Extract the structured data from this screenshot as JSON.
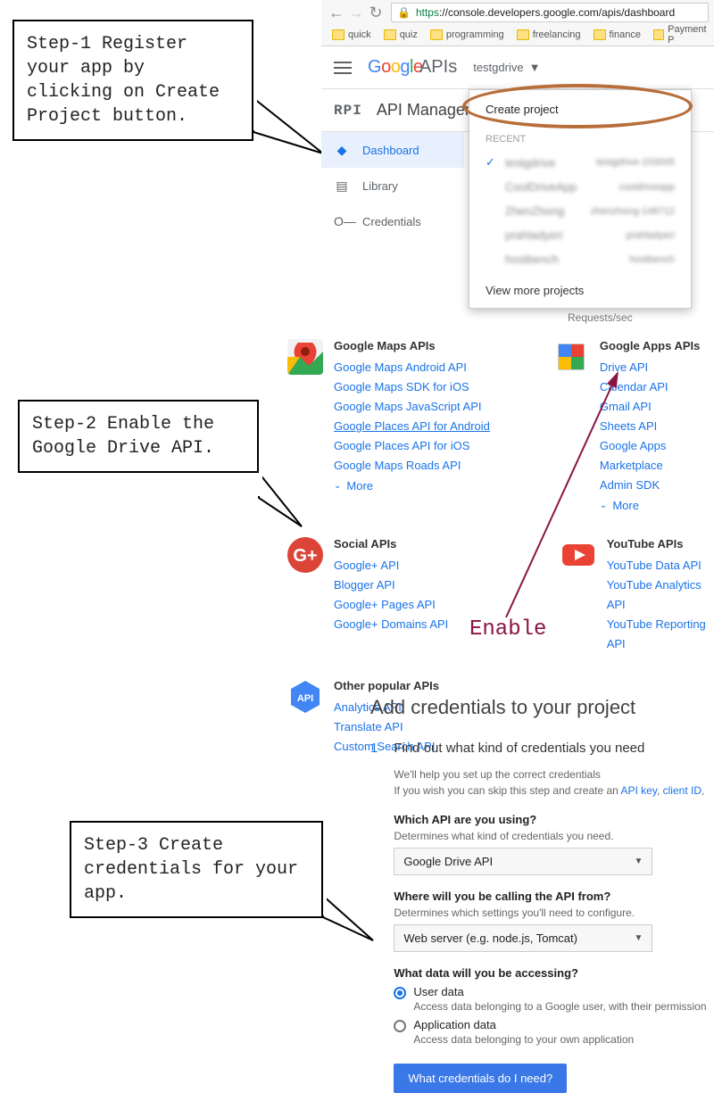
{
  "callouts": {
    "step1": "Step-1 Register your app by clicking on Create Project button.",
    "step2": "Step-2 Enable the Google Drive API.",
    "step3": "Step-3 Create credentials for your app."
  },
  "browser": {
    "url_scheme": "https",
    "url_rest": "://console.developers.google.com/apis/dashboard",
    "bookmarks": [
      "quick",
      "quiz",
      "programming",
      "freelancing",
      "finance",
      "Payment P"
    ]
  },
  "appbar": {
    "logo_text": "Google",
    "apis_text": " APIs",
    "project": "testgdrive"
  },
  "apimgr": {
    "rpi": "RPI",
    "title": "API Manager"
  },
  "nav": {
    "dashboard": "Dashboard",
    "library": "Library",
    "credentials": "Credentials"
  },
  "projdrop": {
    "create": "Create project",
    "recent": "RECENT",
    "items": [
      {
        "name": "testgdrive",
        "id": "testgdrive-153005",
        "checked": true
      },
      {
        "name": "CoolDriveApp",
        "id": "cooldriveapp"
      },
      {
        "name": "ZhenZhong",
        "id": "zhenzhong-148712"
      },
      {
        "name": "prahladyeri",
        "id": "prahladyeri"
      },
      {
        "name": "hostbench",
        "id": "hostbench"
      }
    ],
    "more": "View more projects"
  },
  "reqsec": "Requests/sec",
  "api_groups": {
    "maps": {
      "title": "Google Maps APIs",
      "links": [
        "Google Maps Android API",
        "Google Maps SDK for iOS",
        "Google Maps JavaScript API",
        "Google Places API for Android",
        "Google Places API for iOS",
        "Google Maps Roads API"
      ],
      "more": "More"
    },
    "apps": {
      "title": "Google Apps APIs",
      "links": [
        "Drive API",
        "Calendar API",
        "Gmail API",
        "Sheets API",
        "Google Apps Marketplace",
        "Admin SDK"
      ],
      "more": "More"
    },
    "social": {
      "title": "Social APIs",
      "links": [
        "Google+ API",
        "Blogger API",
        "Google+ Pages API",
        "Google+ Domains API"
      ]
    },
    "youtube": {
      "title": "YouTube APIs",
      "links": [
        "YouTube Data API",
        "YouTube Analytics API",
        "YouTube Reporting API"
      ]
    },
    "other": {
      "title": "Other popular APIs",
      "links": [
        "Analytics API",
        "Translate API",
        "Custom Search API"
      ]
    }
  },
  "enable_label": "Enable",
  "credentials": {
    "title": "Add credentials to your project",
    "step_num": "1",
    "step_head": "Find out what kind of credentials you need",
    "help1": "We'll help you set up the correct credentials",
    "help2_pre": "If you wish you can skip this step and create an ",
    "help2_link1": "API key",
    "help2_mid": ", ",
    "help2_link2": "client ID",
    "q1": "Which API are you using?",
    "q1_sub": "Determines what kind of credentials you need.",
    "q1_sel": "Google Drive API",
    "q2": "Where will you be calling the API from?",
    "q2_sub": "Determines which settings you'll need to configure.",
    "q2_sel": "Web server (e.g. node.js, Tomcat)",
    "q3": "What data will you be accessing?",
    "r1": "User data",
    "r1_sub": "Access data belonging to a Google user, with their permission",
    "r2": "Application data",
    "r2_sub": "Access data belonging to your own application",
    "btn": "What credentials do I need?"
  }
}
